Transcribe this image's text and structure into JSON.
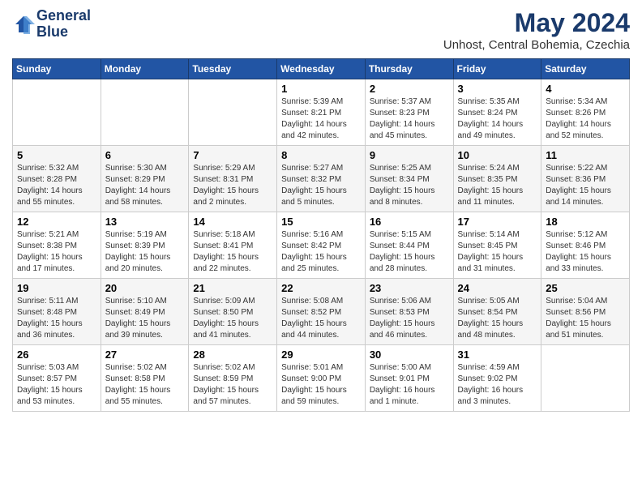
{
  "header": {
    "logo_line1": "General",
    "logo_line2": "Blue",
    "month_title": "May 2024",
    "location": "Unhost, Central Bohemia, Czechia"
  },
  "weekdays": [
    "Sunday",
    "Monday",
    "Tuesday",
    "Wednesday",
    "Thursday",
    "Friday",
    "Saturday"
  ],
  "weeks": [
    [
      {
        "day": "",
        "info": ""
      },
      {
        "day": "",
        "info": ""
      },
      {
        "day": "",
        "info": ""
      },
      {
        "day": "1",
        "info": "Sunrise: 5:39 AM\nSunset: 8:21 PM\nDaylight: 14 hours\nand 42 minutes."
      },
      {
        "day": "2",
        "info": "Sunrise: 5:37 AM\nSunset: 8:23 PM\nDaylight: 14 hours\nand 45 minutes."
      },
      {
        "day": "3",
        "info": "Sunrise: 5:35 AM\nSunset: 8:24 PM\nDaylight: 14 hours\nand 49 minutes."
      },
      {
        "day": "4",
        "info": "Sunrise: 5:34 AM\nSunset: 8:26 PM\nDaylight: 14 hours\nand 52 minutes."
      }
    ],
    [
      {
        "day": "5",
        "info": "Sunrise: 5:32 AM\nSunset: 8:28 PM\nDaylight: 14 hours\nand 55 minutes."
      },
      {
        "day": "6",
        "info": "Sunrise: 5:30 AM\nSunset: 8:29 PM\nDaylight: 14 hours\nand 58 minutes."
      },
      {
        "day": "7",
        "info": "Sunrise: 5:29 AM\nSunset: 8:31 PM\nDaylight: 15 hours\nand 2 minutes."
      },
      {
        "day": "8",
        "info": "Sunrise: 5:27 AM\nSunset: 8:32 PM\nDaylight: 15 hours\nand 5 minutes."
      },
      {
        "day": "9",
        "info": "Sunrise: 5:25 AM\nSunset: 8:34 PM\nDaylight: 15 hours\nand 8 minutes."
      },
      {
        "day": "10",
        "info": "Sunrise: 5:24 AM\nSunset: 8:35 PM\nDaylight: 15 hours\nand 11 minutes."
      },
      {
        "day": "11",
        "info": "Sunrise: 5:22 AM\nSunset: 8:36 PM\nDaylight: 15 hours\nand 14 minutes."
      }
    ],
    [
      {
        "day": "12",
        "info": "Sunrise: 5:21 AM\nSunset: 8:38 PM\nDaylight: 15 hours\nand 17 minutes."
      },
      {
        "day": "13",
        "info": "Sunrise: 5:19 AM\nSunset: 8:39 PM\nDaylight: 15 hours\nand 20 minutes."
      },
      {
        "day": "14",
        "info": "Sunrise: 5:18 AM\nSunset: 8:41 PM\nDaylight: 15 hours\nand 22 minutes."
      },
      {
        "day": "15",
        "info": "Sunrise: 5:16 AM\nSunset: 8:42 PM\nDaylight: 15 hours\nand 25 minutes."
      },
      {
        "day": "16",
        "info": "Sunrise: 5:15 AM\nSunset: 8:44 PM\nDaylight: 15 hours\nand 28 minutes."
      },
      {
        "day": "17",
        "info": "Sunrise: 5:14 AM\nSunset: 8:45 PM\nDaylight: 15 hours\nand 31 minutes."
      },
      {
        "day": "18",
        "info": "Sunrise: 5:12 AM\nSunset: 8:46 PM\nDaylight: 15 hours\nand 33 minutes."
      }
    ],
    [
      {
        "day": "19",
        "info": "Sunrise: 5:11 AM\nSunset: 8:48 PM\nDaylight: 15 hours\nand 36 minutes."
      },
      {
        "day": "20",
        "info": "Sunrise: 5:10 AM\nSunset: 8:49 PM\nDaylight: 15 hours\nand 39 minutes."
      },
      {
        "day": "21",
        "info": "Sunrise: 5:09 AM\nSunset: 8:50 PM\nDaylight: 15 hours\nand 41 minutes."
      },
      {
        "day": "22",
        "info": "Sunrise: 5:08 AM\nSunset: 8:52 PM\nDaylight: 15 hours\nand 44 minutes."
      },
      {
        "day": "23",
        "info": "Sunrise: 5:06 AM\nSunset: 8:53 PM\nDaylight: 15 hours\nand 46 minutes."
      },
      {
        "day": "24",
        "info": "Sunrise: 5:05 AM\nSunset: 8:54 PM\nDaylight: 15 hours\nand 48 minutes."
      },
      {
        "day": "25",
        "info": "Sunrise: 5:04 AM\nSunset: 8:56 PM\nDaylight: 15 hours\nand 51 minutes."
      }
    ],
    [
      {
        "day": "26",
        "info": "Sunrise: 5:03 AM\nSunset: 8:57 PM\nDaylight: 15 hours\nand 53 minutes."
      },
      {
        "day": "27",
        "info": "Sunrise: 5:02 AM\nSunset: 8:58 PM\nDaylight: 15 hours\nand 55 minutes."
      },
      {
        "day": "28",
        "info": "Sunrise: 5:02 AM\nSunset: 8:59 PM\nDaylight: 15 hours\nand 57 minutes."
      },
      {
        "day": "29",
        "info": "Sunrise: 5:01 AM\nSunset: 9:00 PM\nDaylight: 15 hours\nand 59 minutes."
      },
      {
        "day": "30",
        "info": "Sunrise: 5:00 AM\nSunset: 9:01 PM\nDaylight: 16 hours\nand 1 minute."
      },
      {
        "day": "31",
        "info": "Sunrise: 4:59 AM\nSunset: 9:02 PM\nDaylight: 16 hours\nand 3 minutes."
      },
      {
        "day": "",
        "info": ""
      }
    ]
  ]
}
